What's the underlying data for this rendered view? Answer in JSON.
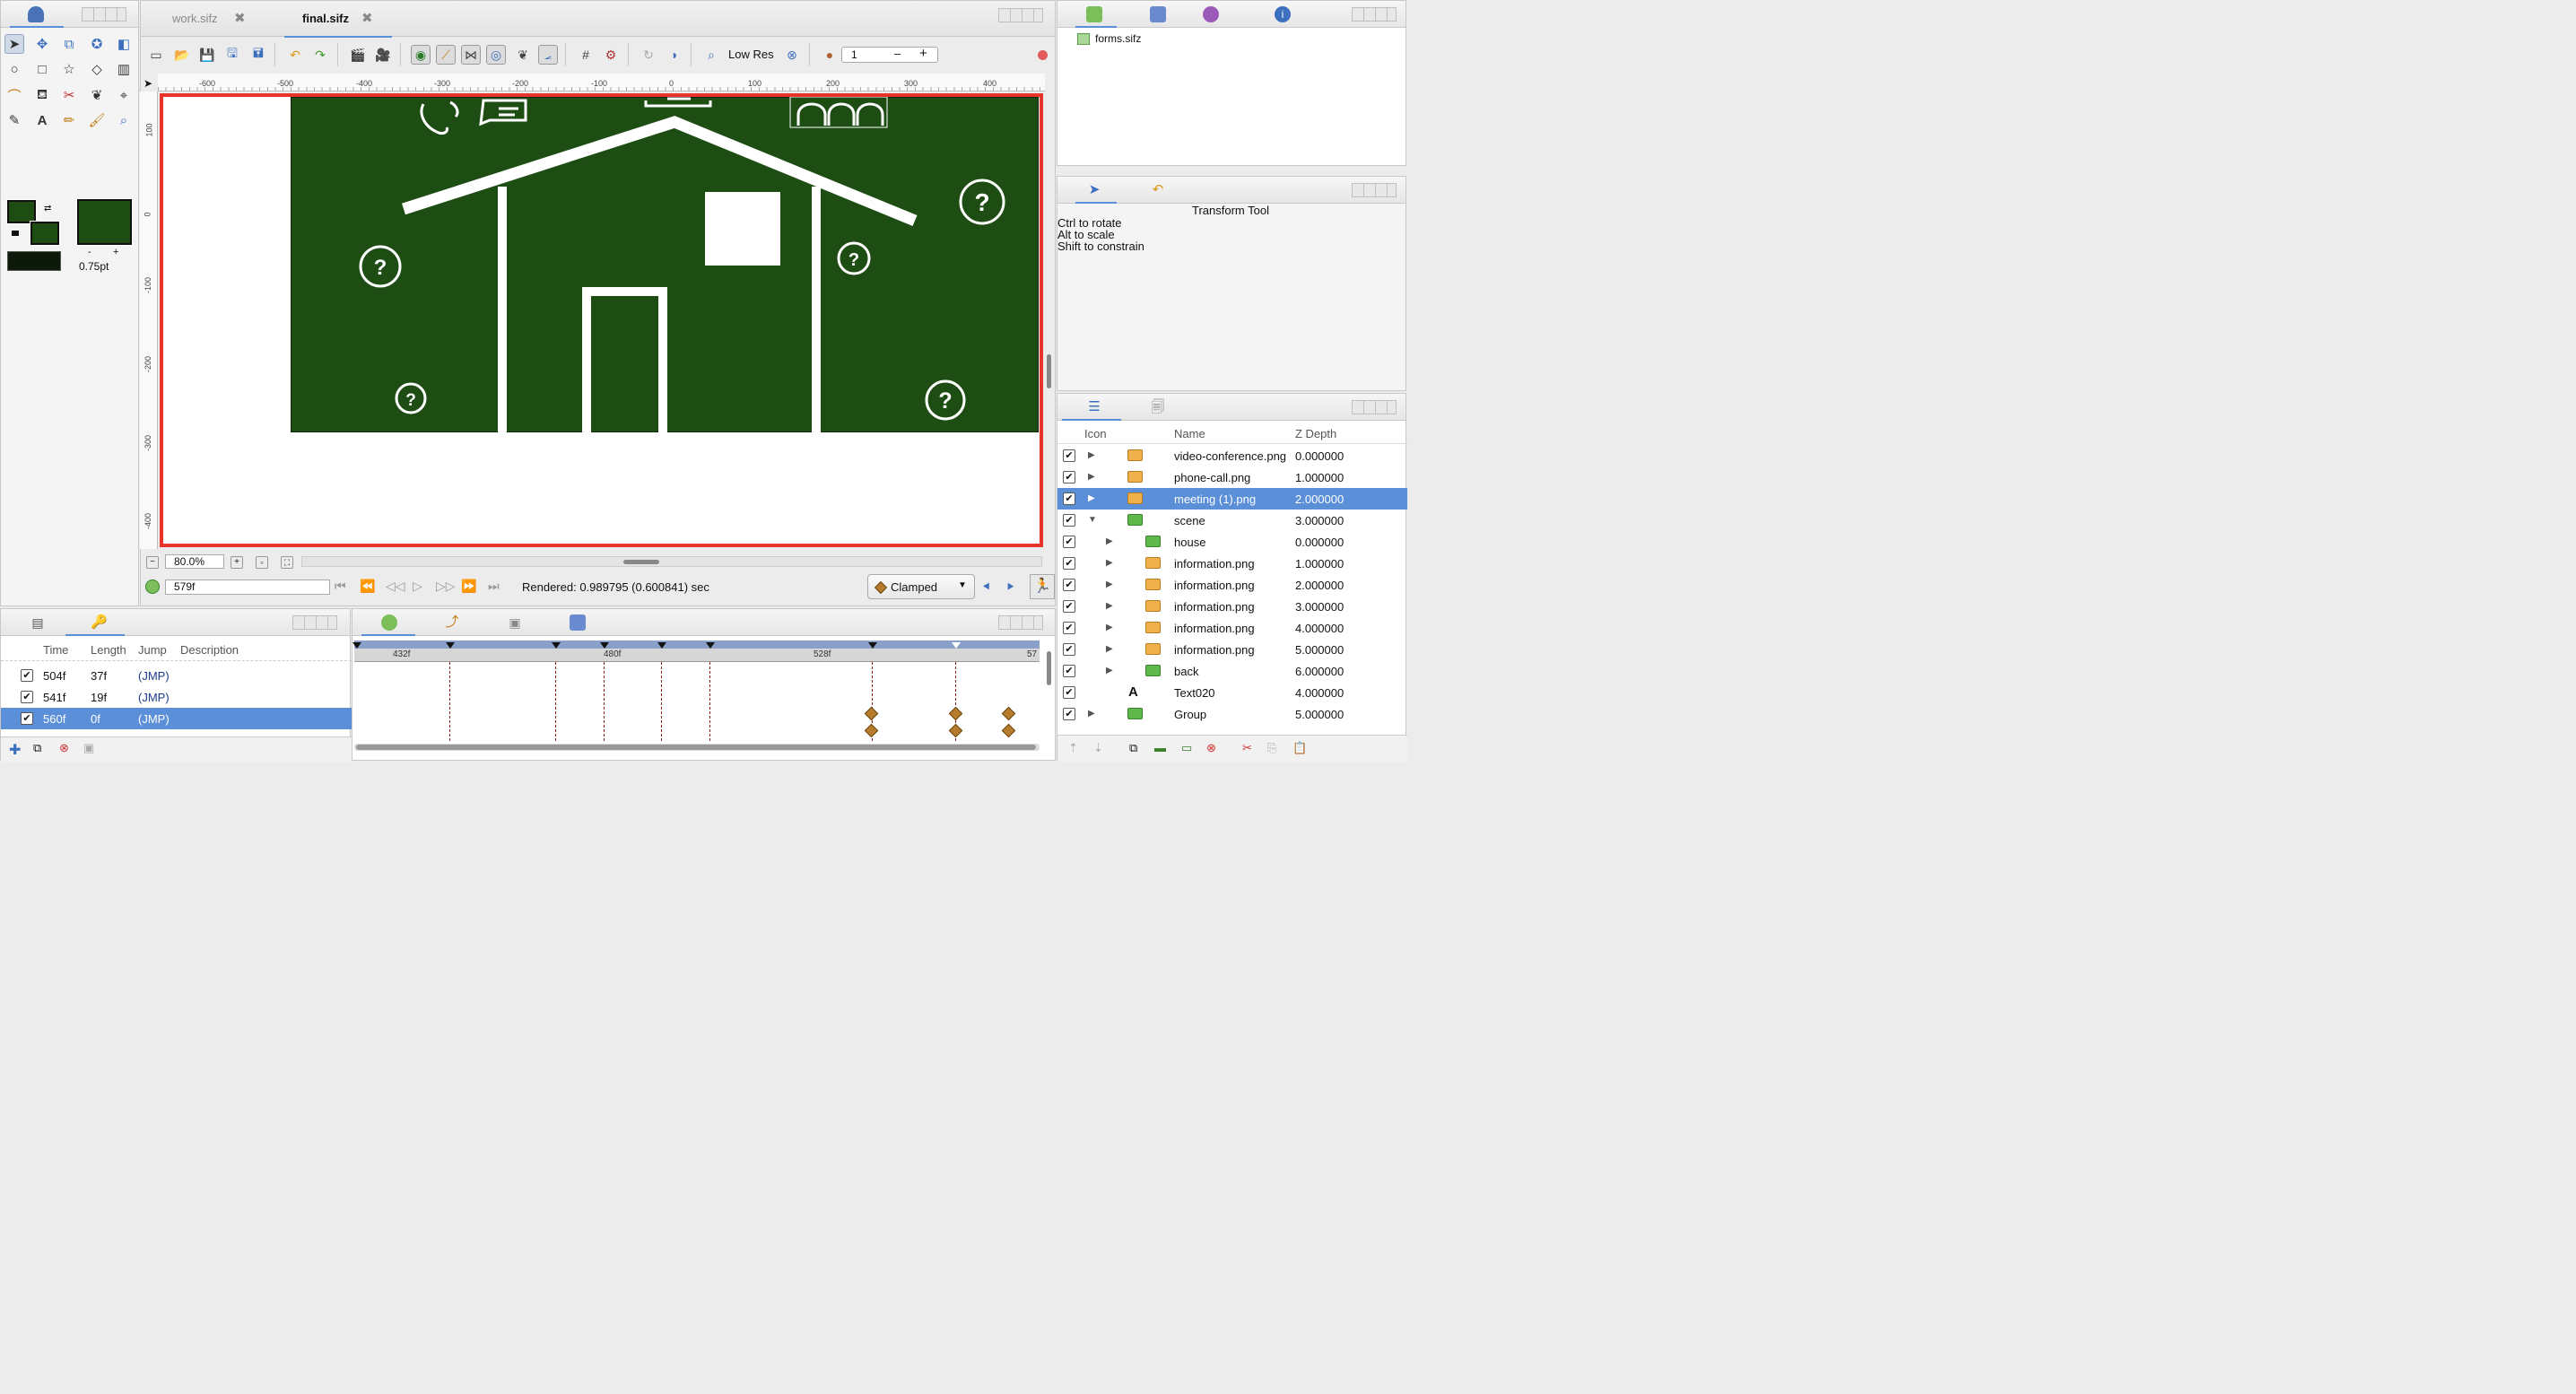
{
  "colors": {
    "canvas_bg": "#1e4d14",
    "border_red": "#e8342a",
    "select_blue": "#5b8fd8",
    "keyframe": "#b67b2c"
  },
  "tabs": {
    "file_tabs": [
      {
        "label": "work.sifz"
      },
      {
        "label": "final.sifz"
      }
    ]
  },
  "toolbar": {
    "quality_label": "Low Res",
    "frame_value": "1",
    "minus": "–",
    "plus": "+"
  },
  "ruler": {
    "h": [
      "-600",
      "-500",
      "-400",
      "-300",
      "-200",
      "-100",
      "0",
      "100",
      "200",
      "300",
      "400"
    ],
    "v": [
      "100",
      "0",
      "-100",
      "-200",
      "-300",
      "-400"
    ]
  },
  "toolbox": {
    "brush_size": "0.75pt",
    "minus": "-",
    "plus": "+"
  },
  "canvas_footer": {
    "zoom": "80.0%",
    "current_frame": "579f",
    "render_status": "Rendered: 0.989795 (0.600841) sec",
    "interpolation": "Clamped"
  },
  "canvas_browser": {
    "file": "forms.sifz"
  },
  "tool_options": {
    "title": "Transform Tool",
    "lines": [
      "Ctrl to rotate",
      "Alt to scale",
      "Shift to constrain"
    ]
  },
  "layers": {
    "headers": {
      "icon": "Icon",
      "name": "Name",
      "zdepth": "Z Depth"
    },
    "rows": [
      {
        "name": "video-conference.png",
        "z": "0.000000",
        "kind": "org",
        "indent": 0,
        "expand": "right",
        "sel": false
      },
      {
        "name": "phone-call.png",
        "z": "1.000000",
        "kind": "org",
        "indent": 0,
        "expand": "right",
        "sel": false
      },
      {
        "name": "meeting (1).png",
        "z": "2.000000",
        "kind": "org",
        "indent": 0,
        "expand": "right",
        "sel": true
      },
      {
        "name": "scene",
        "z": "3.000000",
        "kind": "grn",
        "indent": 0,
        "expand": "down",
        "sel": false
      },
      {
        "name": "house",
        "z": "0.000000",
        "kind": "grn",
        "indent": 1,
        "expand": "right",
        "sel": false
      },
      {
        "name": "information.png",
        "z": "1.000000",
        "kind": "org",
        "indent": 1,
        "expand": "right",
        "sel": false
      },
      {
        "name": "information.png",
        "z": "2.000000",
        "kind": "org",
        "indent": 1,
        "expand": "right",
        "sel": false
      },
      {
        "name": "information.png",
        "z": "3.000000",
        "kind": "org",
        "indent": 1,
        "expand": "right",
        "sel": false
      },
      {
        "name": "information.png",
        "z": "4.000000",
        "kind": "org",
        "indent": 1,
        "expand": "right",
        "sel": false
      },
      {
        "name": "information.png",
        "z": "5.000000",
        "kind": "org",
        "indent": 1,
        "expand": "right",
        "sel": false
      },
      {
        "name": "back",
        "z": "6.000000",
        "kind": "grn",
        "indent": 1,
        "expand": "right",
        "sel": false
      },
      {
        "name": "Text020",
        "z": "4.000000",
        "kind": "text",
        "indent": 0,
        "expand": "none",
        "sel": false
      },
      {
        "name": "Group",
        "z": "5.000000",
        "kind": "grn",
        "indent": 0,
        "expand": "right",
        "sel": false
      }
    ]
  },
  "keyframes": {
    "headers": {
      "time": "Time",
      "length": "Length",
      "jump": "Jump",
      "description": "Description"
    },
    "rows": [
      {
        "time": "504f",
        "length": "37f",
        "jump": "(JMP)",
        "sel": false
      },
      {
        "time": "541f",
        "length": "19f",
        "jump": "(JMP)",
        "sel": false
      },
      {
        "time": "560f",
        "length": "0f",
        "jump": "(JMP)",
        "sel": true
      }
    ]
  },
  "timetrack": {
    "labels": [
      "432f",
      "480f",
      "528f",
      "57"
    ]
  }
}
